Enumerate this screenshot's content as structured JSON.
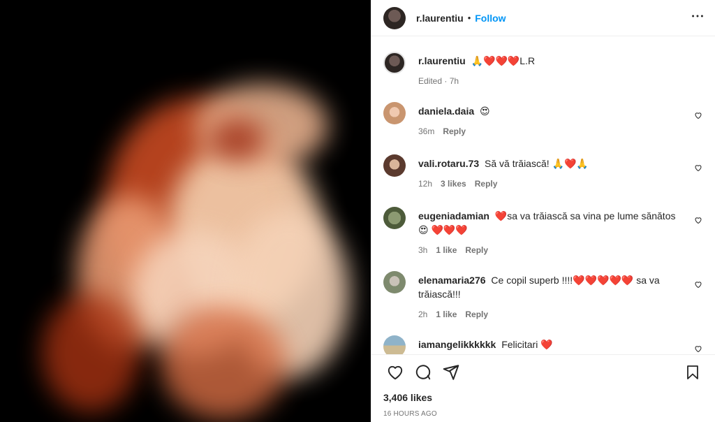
{
  "post": {
    "username": "r.laurentiu",
    "follow_label": "Follow",
    "more_icon": "more-horizontal-icon"
  },
  "caption": {
    "username": "r.laurentiu",
    "text": "🙏❤️❤️❤️L.R",
    "edited": "Edited · 7h"
  },
  "comments": [
    {
      "username": "daniela.daia",
      "text": "😍",
      "time": "36m",
      "likes": "",
      "reply": "Reply"
    },
    {
      "username": "vali.rotaru.73",
      "text": "Să vă trăiască! 🙏❤️🙏",
      "time": "12h",
      "likes": "3 likes",
      "reply": "Reply"
    },
    {
      "username": "eugeniadamian",
      "text": "❤️sa va trăiască sa vina pe lume sănătos 😍 ❤️❤️❤️",
      "time": "3h",
      "likes": "1 like",
      "reply": "Reply"
    },
    {
      "username": "elenamaria276",
      "text": "Ce copil superb !!!!❤️❤️❤️❤️❤️ sa va trăiască!!!",
      "time": "2h",
      "likes": "1 like",
      "reply": "Reply"
    },
    {
      "username": "iamangelikkkkkk",
      "text": "Felicitari ❤️",
      "time": "",
      "likes": "",
      "reply": ""
    }
  ],
  "likes_count": "3,406 likes",
  "timestamp": "16 HOURS AGO",
  "colors": {
    "accent": "#0095f6",
    "heart": "#ed1c2e",
    "muted": "#737373"
  }
}
